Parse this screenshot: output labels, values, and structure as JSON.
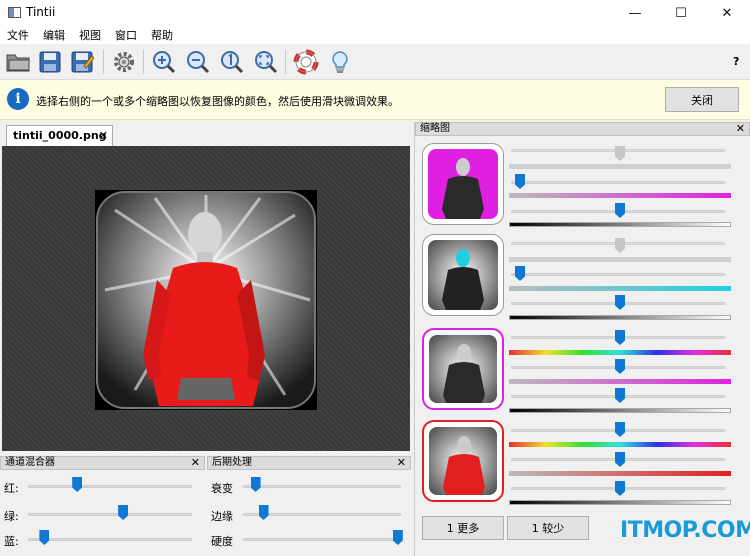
{
  "window": {
    "title": "Tintii"
  },
  "menu": [
    "文件",
    "编辑",
    "视图",
    "窗口",
    "帮助"
  ],
  "toolbar": {
    "help": "?"
  },
  "infobar": {
    "message": "选择右侧的一个或多个缩略图以恢复图像的颜色，然后使用滑块微调效果。",
    "close_label": "关闭"
  },
  "tab": {
    "label": "tintii_0000.png",
    "close": "✕"
  },
  "channel_mixer": {
    "title": "通道混合器",
    "close": "✕",
    "red_label": "红:",
    "green_label": "绿:",
    "blue_label": "蓝:",
    "red_value": 0.3,
    "green_value": 0.58,
    "blue_value": 0.1
  },
  "post_processing": {
    "title": "后期处理",
    "close": "✕",
    "decay_label": "衰变",
    "edge_label": "边缘",
    "hardness_label": "硬度",
    "decay_value": 0.08,
    "edge_value": 0.13,
    "hardness_value": 0.98
  },
  "thumbnails": {
    "title": "缩略图",
    "close": "✕",
    "more_label": "1 更多",
    "less_label": "1 较少"
  },
  "watermark": "ITMOP.COM",
  "colors": {
    "accent": "#0f77d4",
    "magenta": "#e020e0",
    "cyan": "#20d0e0",
    "red_shirt": "#e02020",
    "info_bg": "#fffde1"
  }
}
